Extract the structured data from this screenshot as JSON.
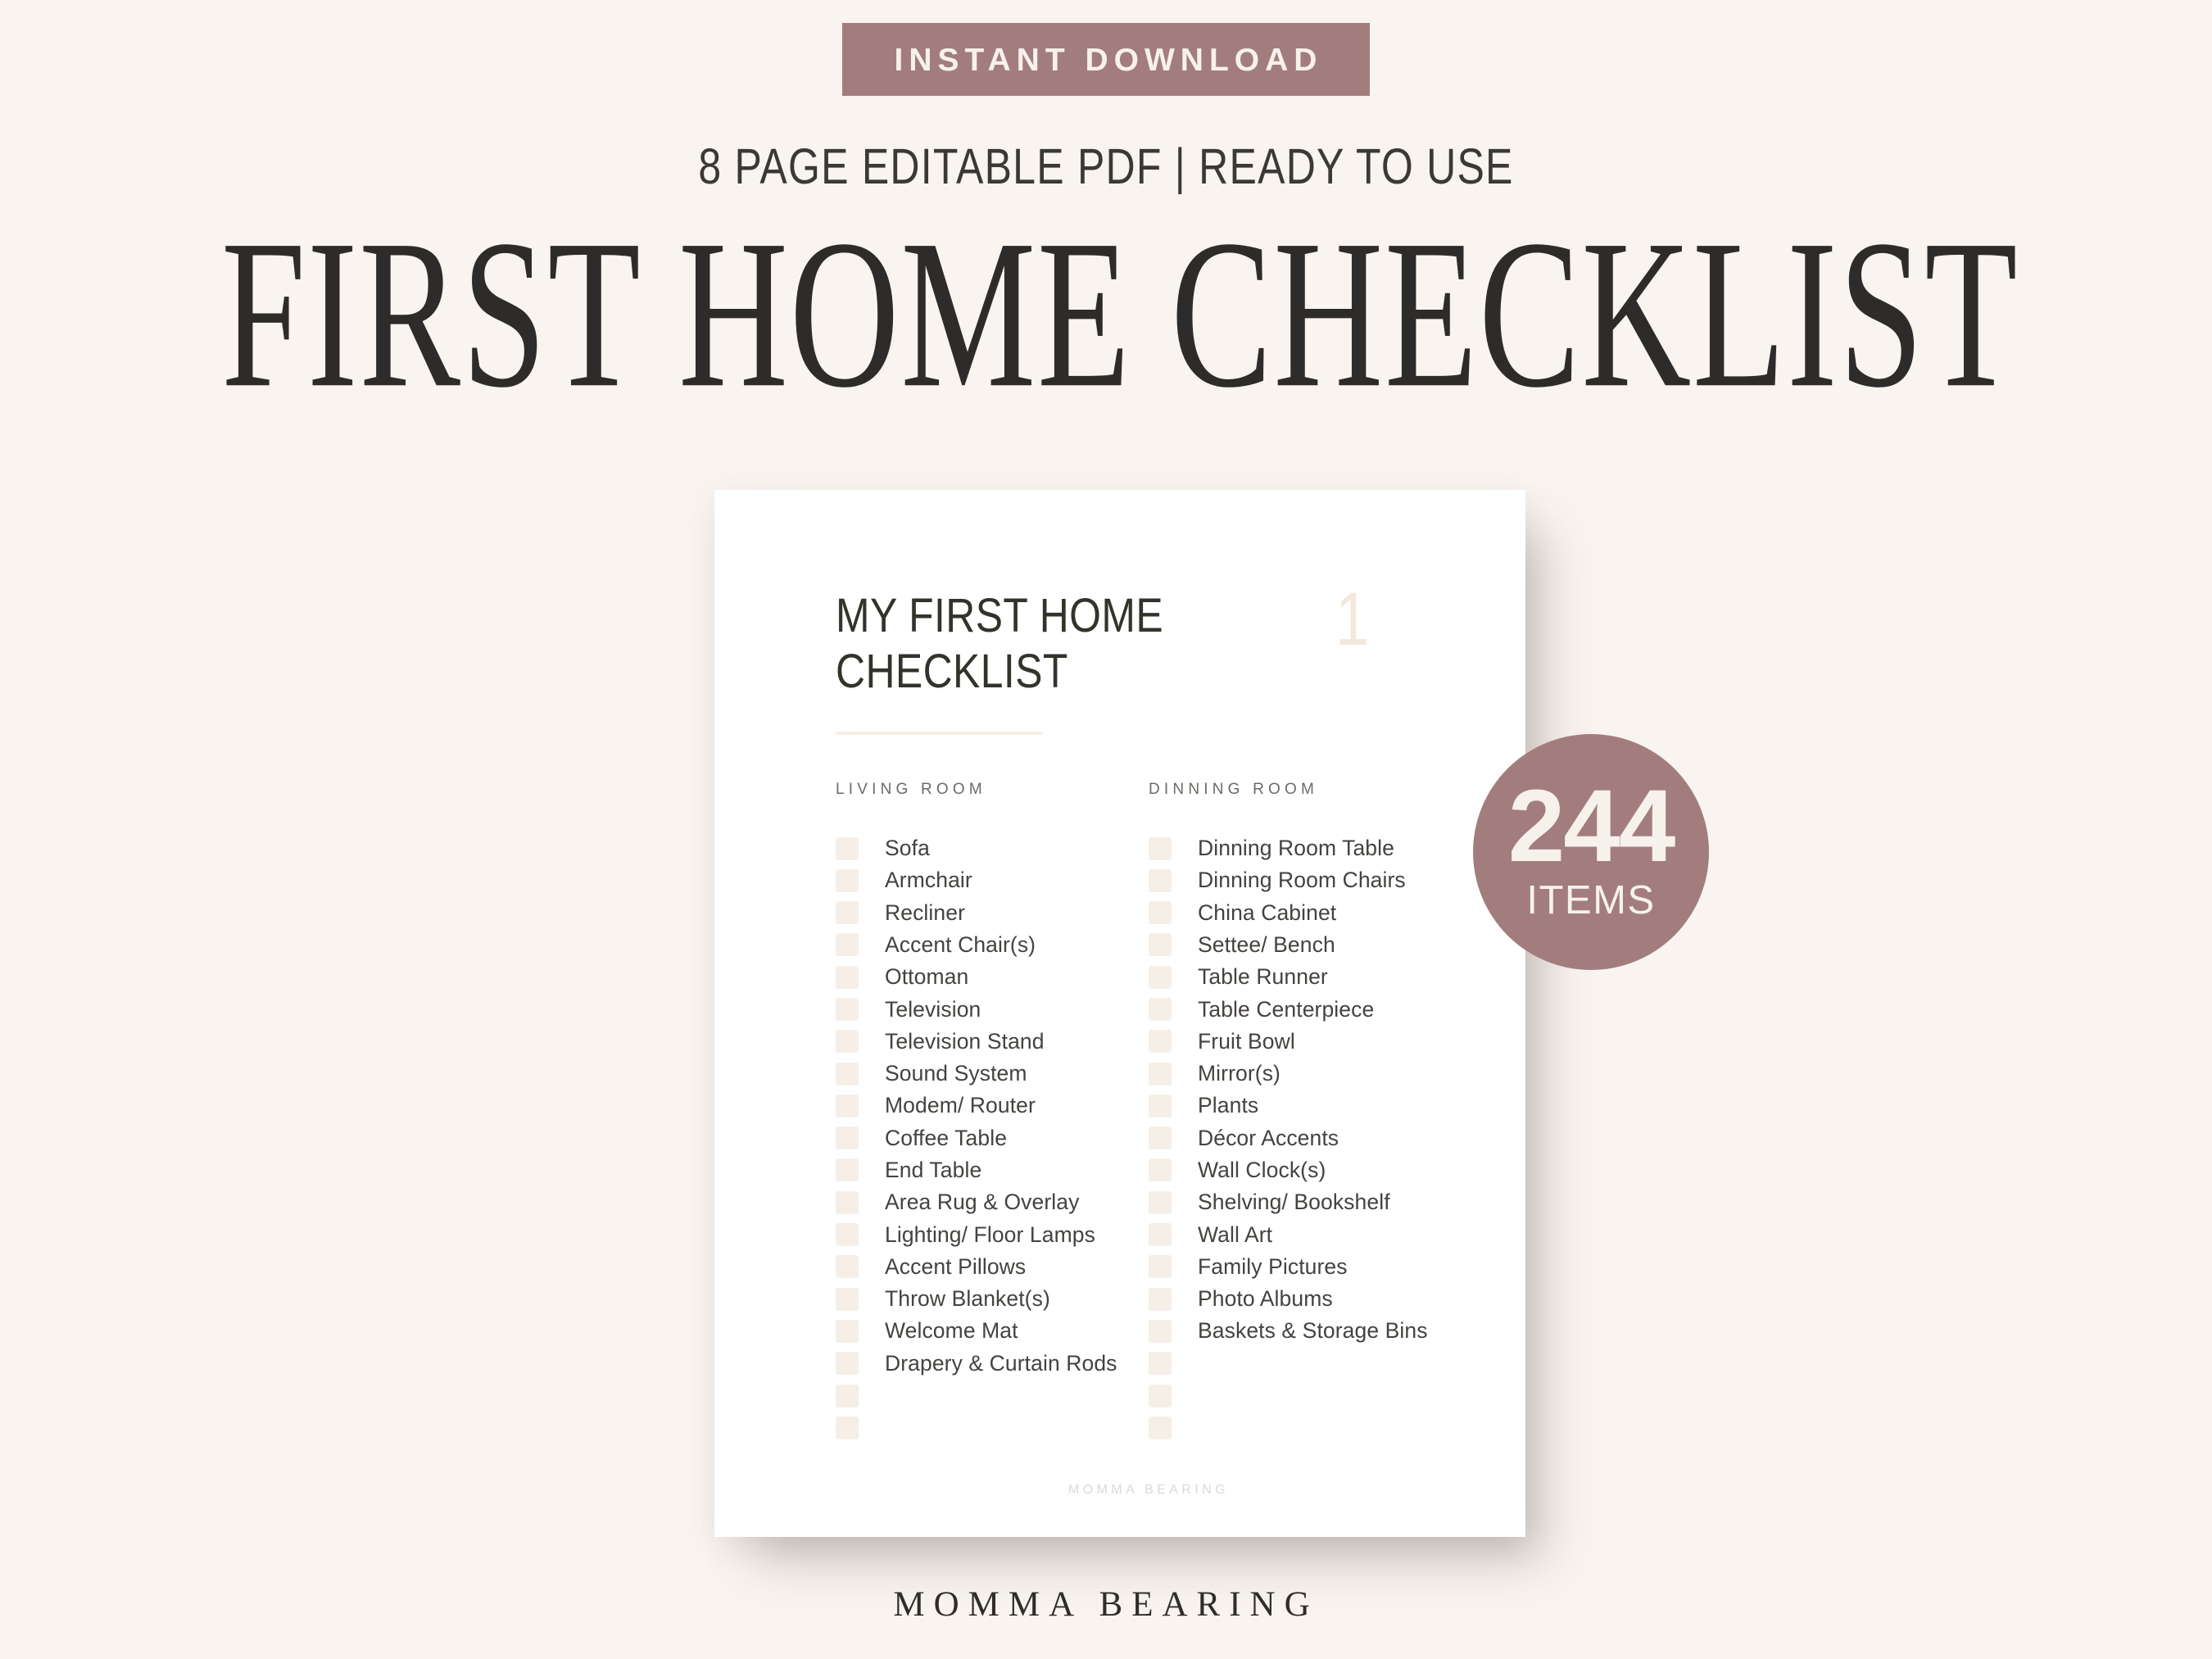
{
  "colors": {
    "background": "#f9f4f0",
    "accent": "#a37d7e",
    "accent_text": "#f7f1ec",
    "title": "#2e2c2b",
    "checkbox": "#f5efe8",
    "page_number": "#f2e8dc",
    "card": "#ffffff"
  },
  "header": {
    "badge_label": "INSTANT DOWNLOAD",
    "subtitle": "8 PAGE EDITABLE PDF | READY TO USE",
    "title": "FIRST HOME CHECKLIST"
  },
  "items_badge": {
    "count": "244",
    "unit": "ITEMS"
  },
  "footer": {
    "brand": "MOMMA BEARING"
  },
  "document": {
    "title": "MY FIRST HOME\nCHECKLIST",
    "page_number": "1",
    "watermark": "MOMMA BEARING",
    "columns": [
      {
        "heading": "LIVING ROOM",
        "items": [
          "Sofa",
          "Armchair",
          "Recliner",
          "Accent Chair(s)",
          "Ottoman",
          "Television",
          "Television Stand",
          "Sound System",
          "Modem/ Router",
          "Coffee Table",
          "End Table",
          "Area Rug & Overlay",
          "Lighting/ Floor Lamps",
          "Accent Pillows",
          "Throw Blanket(s)",
          "Welcome Mat",
          "Drapery & Curtain Rods",
          "",
          ""
        ]
      },
      {
        "heading": "DINNING ROOM",
        "items": [
          "Dinning Room Table",
          "Dinning Room Chairs",
          "China Cabinet",
          "Settee/ Bench",
          "Table Runner",
          "Table Centerpiece",
          "Fruit Bowl",
          "Mirror(s)",
          "Plants",
          "Décor Accents",
          "Wall Clock(s)",
          "Shelving/ Bookshelf",
          "Wall Art",
          "Family Pictures",
          "Photo Albums",
          "Baskets & Storage Bins",
          "",
          "",
          ""
        ]
      }
    ]
  }
}
